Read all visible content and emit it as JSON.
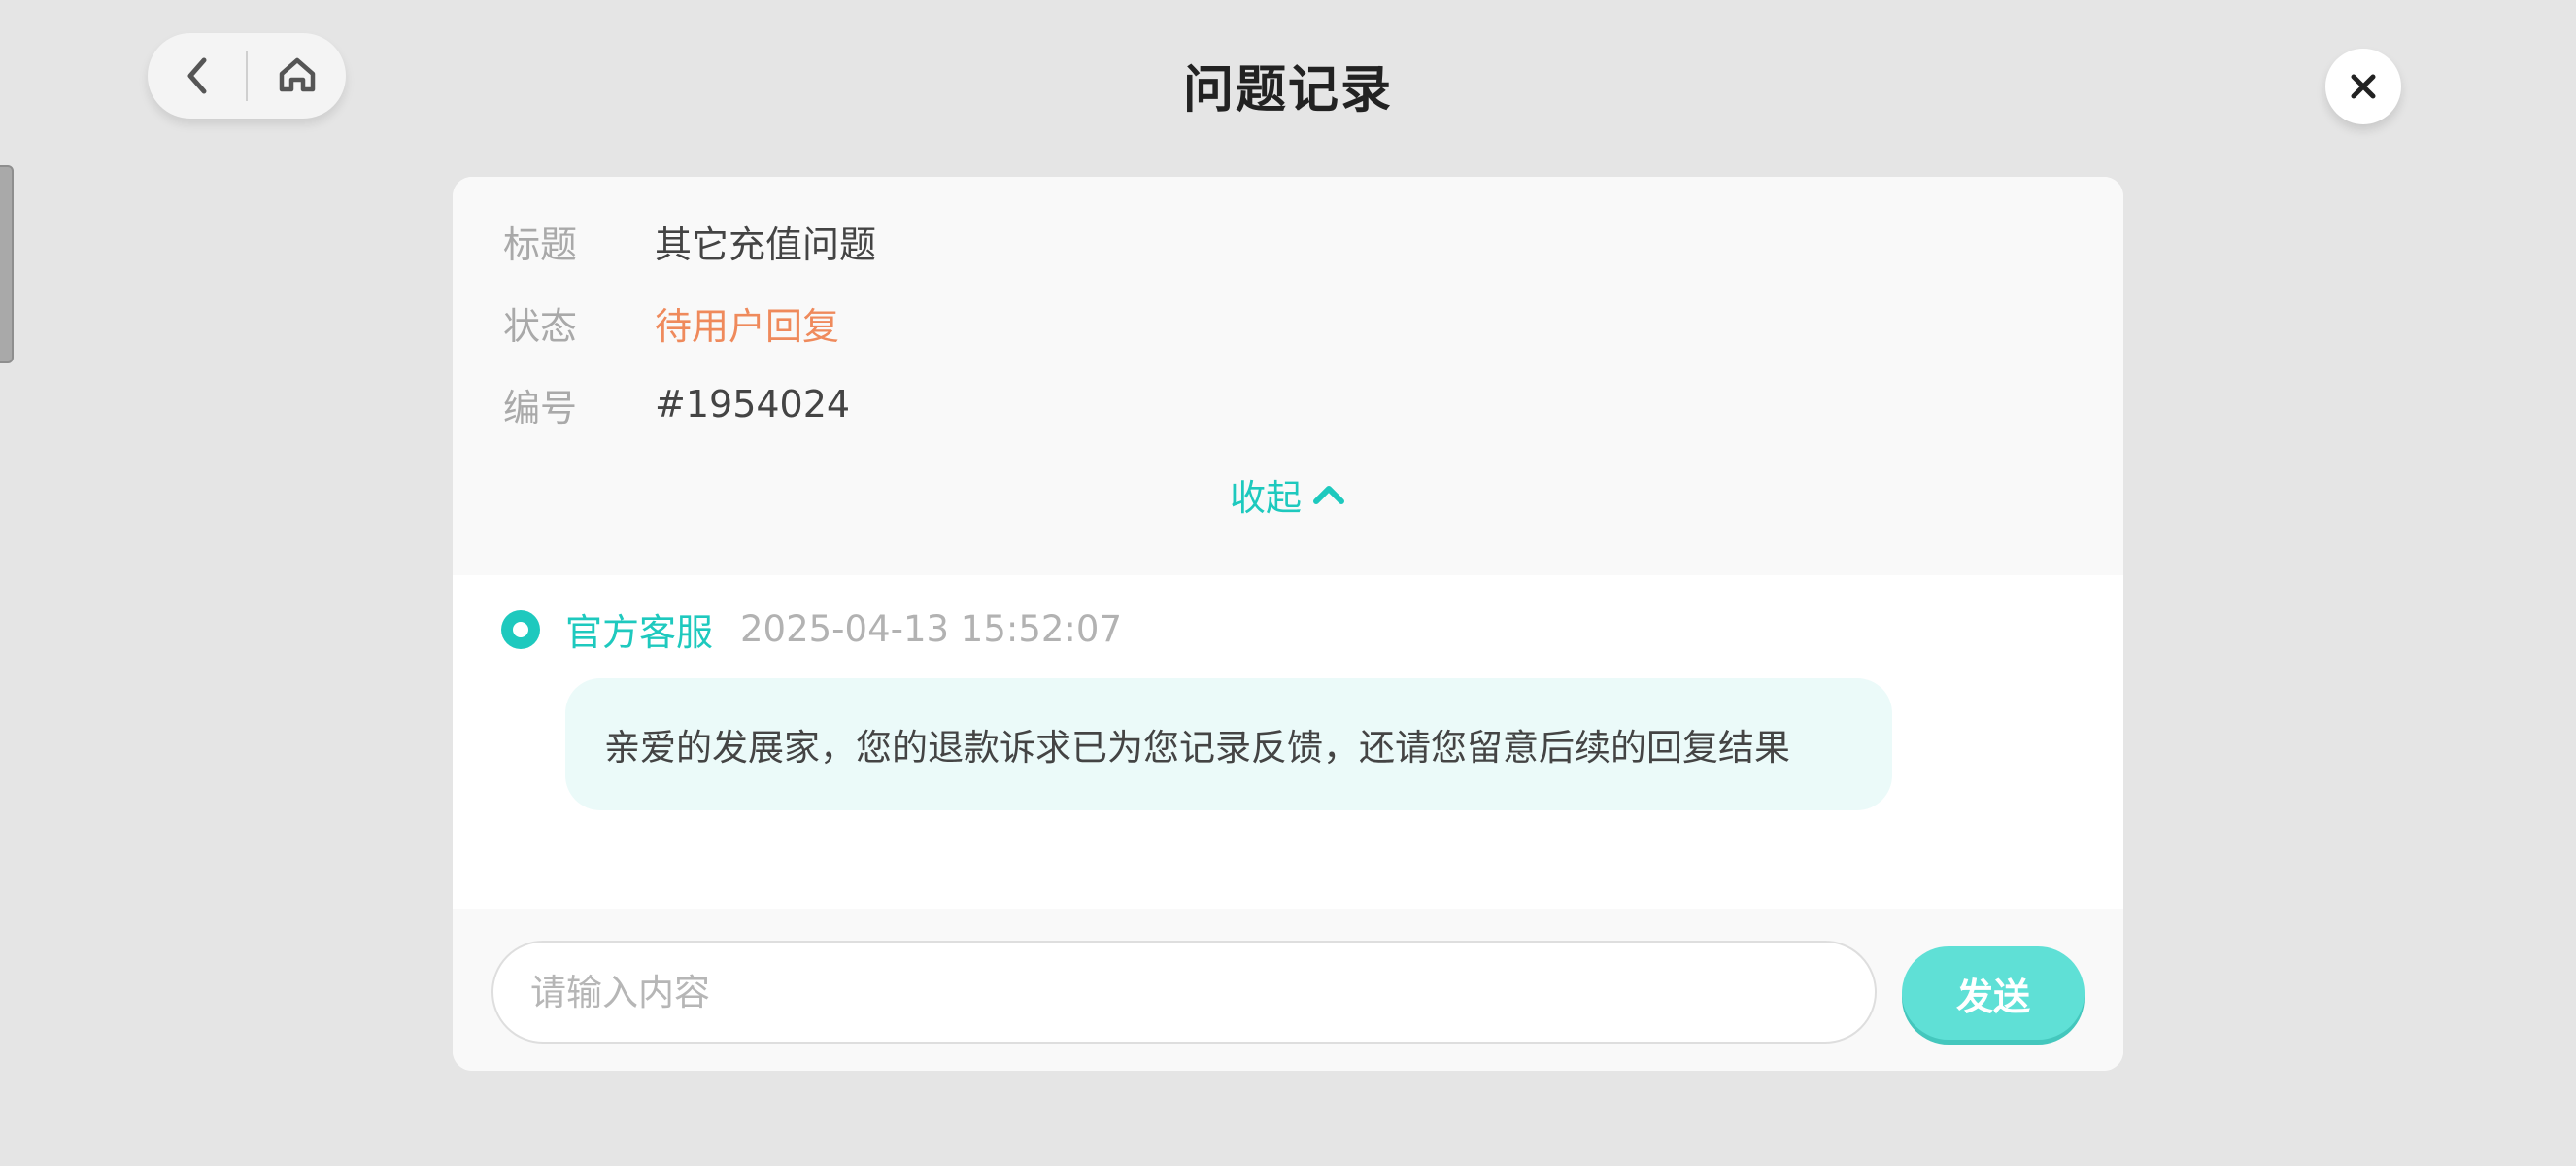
{
  "header": {
    "title": "问题记录",
    "back_icon": "chevron-left-icon",
    "home_icon": "home-icon",
    "close_icon": "close-icon"
  },
  "info": {
    "title_label": "标题",
    "title_value": "其它充值问题",
    "status_label": "状态",
    "status_value": "待用户回复",
    "number_label": "编号",
    "number_value": "#1954024",
    "collapse_label": "收起",
    "collapse_icon": "chevron-up-icon"
  },
  "message": {
    "sender": "官方客服",
    "time": "2025-04-13 15:52:07",
    "text": "亲爱的发展家，您的退款诉求已为您记录反馈，还请您留意后续的回复结果"
  },
  "composer": {
    "placeholder": "请输入内容",
    "value": "",
    "send_label": "发送"
  },
  "colors": {
    "accent": "#1ec9be",
    "status": "#ef8a5c",
    "send_button": "#5fe0d6",
    "bubble": "#ebfaf9",
    "background": "#e5e5e5"
  }
}
